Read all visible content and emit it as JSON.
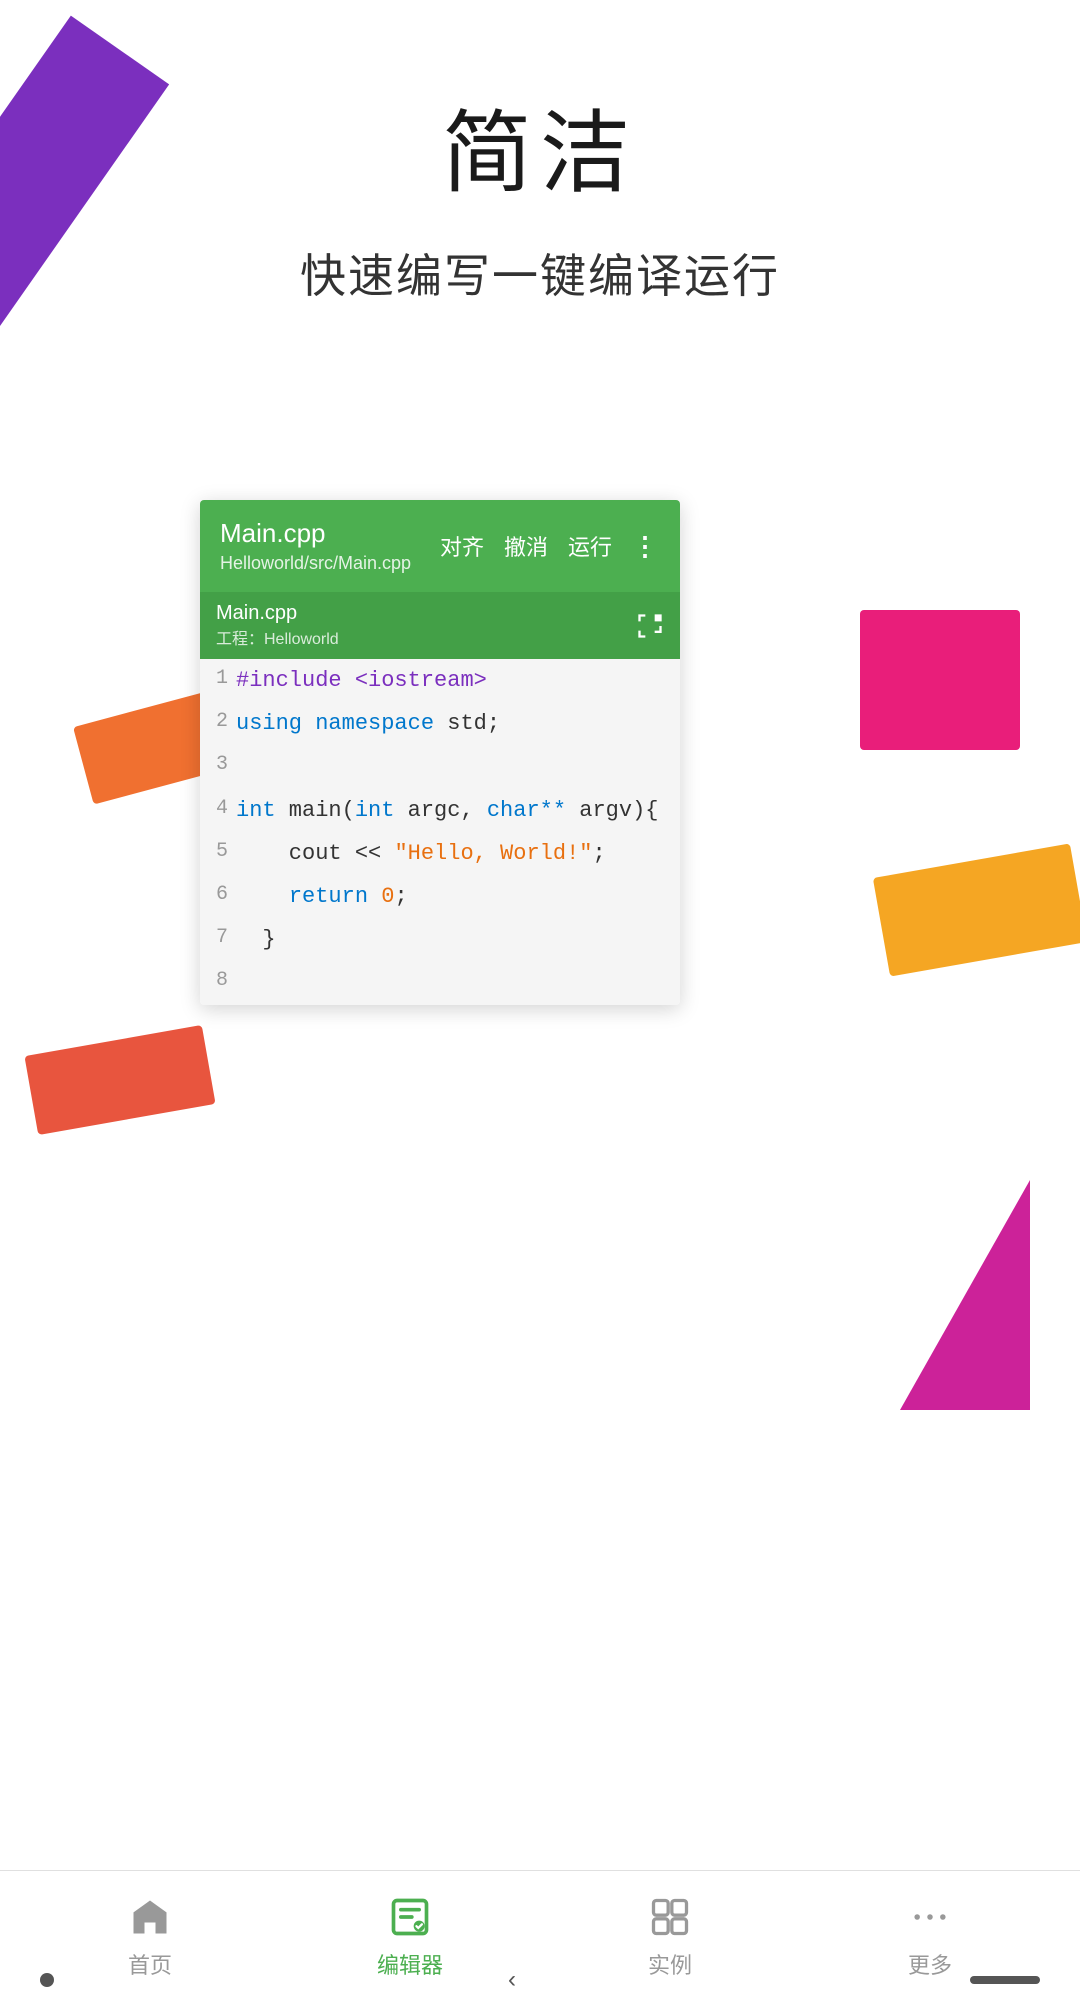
{
  "page": {
    "title": "简洁",
    "subtitle": "快速编写一键编译运行"
  },
  "editor": {
    "filename": "Main.cpp",
    "filepath": "Helloworld/src/Main.cpp",
    "tab_name": "Main.cpp",
    "tab_project": "工程：Helloworld",
    "toolbar": {
      "align": "对齐",
      "undo": "撤消",
      "run": "运行",
      "more": "⋮"
    },
    "code_lines": [
      {
        "num": "1",
        "content": "#include <iostream>"
      },
      {
        "num": "2",
        "content": "using namespace std;"
      },
      {
        "num": "3",
        "content": ""
      },
      {
        "num": "4",
        "content": "int main(int argc, char** argv){"
      },
      {
        "num": "5",
        "content": "    cout << \"Hello, World!\";"
      },
      {
        "num": "6",
        "content": "    return 0;"
      },
      {
        "num": "7",
        "content": "  }"
      },
      {
        "num": "8",
        "content": ""
      }
    ]
  },
  "nav": {
    "items": [
      {
        "id": "home",
        "label": "首页",
        "active": false
      },
      {
        "id": "editor",
        "label": "编辑器",
        "active": true
      },
      {
        "id": "examples",
        "label": "实例",
        "active": false
      },
      {
        "id": "more",
        "label": "更多",
        "active": false
      }
    ]
  },
  "colors": {
    "green": "#4CAF50",
    "purple": "#7B2FBE",
    "pink": "#E91E7A",
    "orange": "#F5A623",
    "red": "#E8553E",
    "magenta": "#CC2299"
  }
}
